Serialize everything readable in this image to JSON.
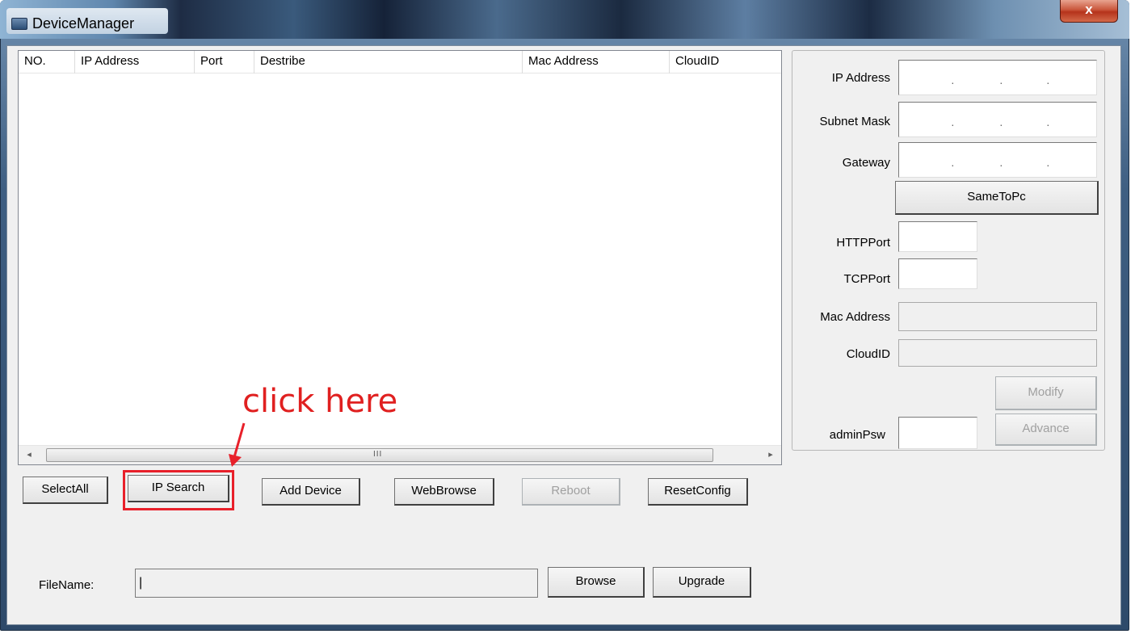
{
  "window": {
    "title": "DeviceManager",
    "close_glyph": "x"
  },
  "device_list": {
    "columns": [
      "NO.",
      "IP Address",
      "Port",
      "Destribe",
      "Mac Address",
      "CloudID"
    ],
    "rows": [],
    "scroll_left": "◂",
    "scroll_right": "▸",
    "grip": "III"
  },
  "buttons": {
    "select_all": "SelectAll",
    "ip_search": "IP Search",
    "add_device": "Add Device",
    "web_browse": "WebBrowse",
    "reboot": "Reboot",
    "reset_config": "ResetConfig",
    "browse": "Browse",
    "upgrade": "Upgrade",
    "same_to_pc": "SameToPc",
    "modify": "Modify",
    "advance": "Advance"
  },
  "annotation": {
    "callout": "click here",
    "color": "#e02020"
  },
  "config": {
    "ip_address_label": "IP Address",
    "subnet_mask_label": "Subnet Mask",
    "gateway_label": "Gateway",
    "http_port_label": "HTTPPort",
    "tcp_port_label": "TCPPort",
    "mac_address_label": "Mac Address",
    "cloud_id_label": "CloudID",
    "admin_psw_label": "adminPsw",
    "ip_separator": "·",
    "ip_address_value": "",
    "subnet_mask_value": "",
    "gateway_value": "",
    "http_port_value": "",
    "tcp_port_value": "",
    "mac_address_value": "",
    "cloud_id_value": "",
    "admin_psw_value": ""
  },
  "upgrade": {
    "filename_label": "FileName:",
    "filename_value": "|"
  }
}
